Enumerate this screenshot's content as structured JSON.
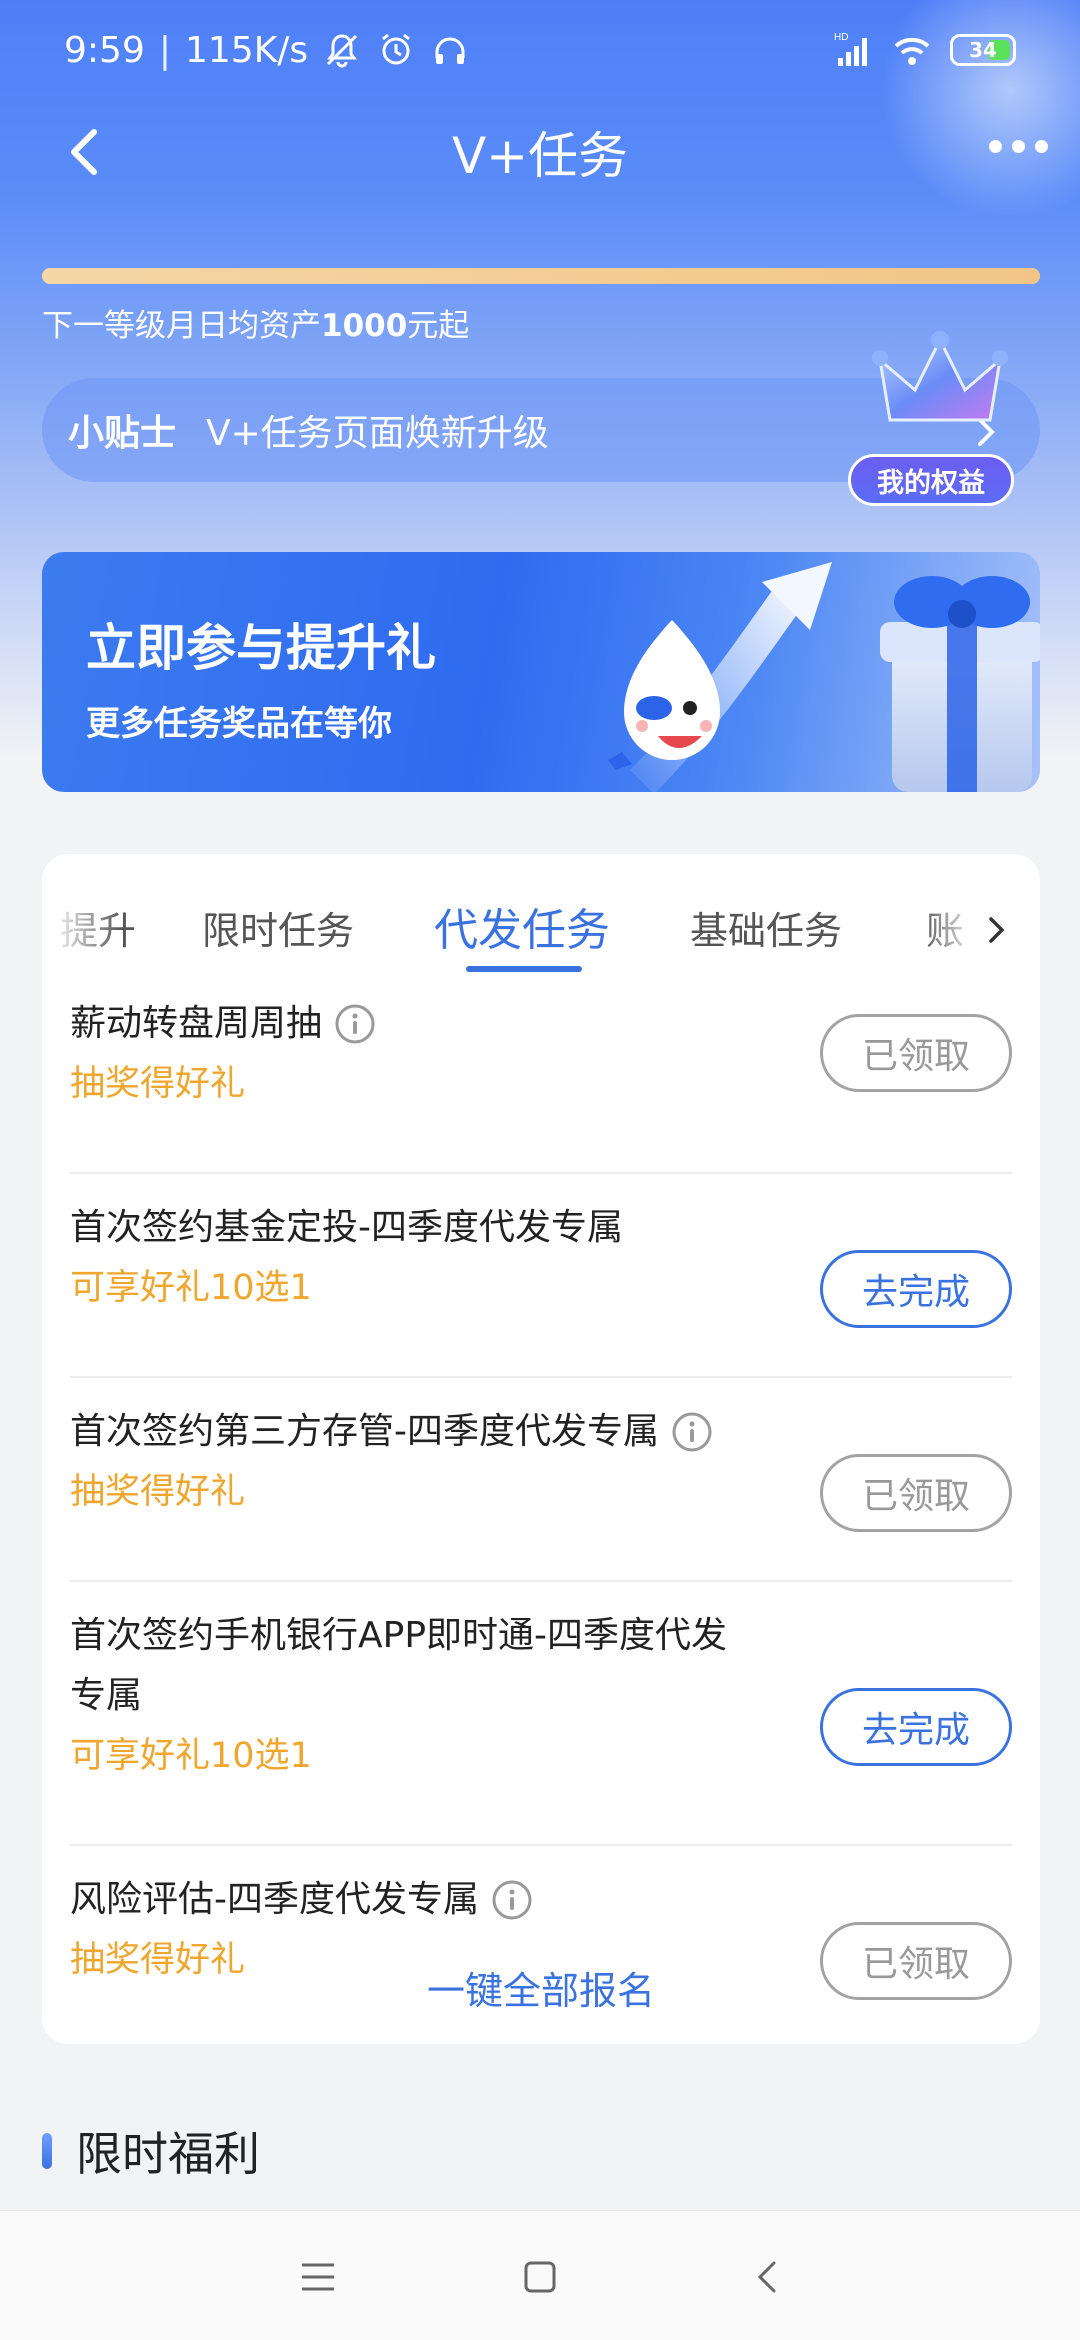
{
  "status_bar": {
    "time": "9:59",
    "separator": "|",
    "network_speed": "115K/s",
    "signal_label": "HD",
    "battery": "34"
  },
  "nav": {
    "title": "V+任务"
  },
  "level": {
    "progress": 1.0,
    "hint_prefix": "下一等级月日均资产",
    "hint_amount": "1000",
    "hint_suffix": "元起"
  },
  "tips": {
    "label": "小贴士",
    "text": "V+任务页面焕新升级",
    "rights_badge": "我的权益"
  },
  "banner": {
    "title": "立即参与提升礼",
    "subtitle": "更多任务奖品在等你"
  },
  "tabs": [
    {
      "label": "提升",
      "active": false
    },
    {
      "label": "限时任务",
      "active": false
    },
    {
      "label": "代发任务",
      "active": true
    },
    {
      "label": "基础任务",
      "active": false
    },
    {
      "label": "账",
      "active": false
    }
  ],
  "tasks": [
    {
      "title": "薪动转盘周周抽",
      "has_info": true,
      "reward": "抽奖得好礼",
      "button": "已领取",
      "state": "done"
    },
    {
      "title": "首次签约基金定投-四季度代发专属",
      "has_info": false,
      "reward": "可享好礼10选1",
      "button": "去完成",
      "state": "go"
    },
    {
      "title": "首次签约第三方存管-四季度代发专属",
      "has_info": true,
      "reward": "抽奖得好礼",
      "button": "已领取",
      "state": "done"
    },
    {
      "title_line1": "首次签约手机银行APP即时通-四季度代发",
      "title_line2": "专属",
      "has_info": false,
      "reward": "可享好礼10选1",
      "button": "去完成",
      "state": "go"
    },
    {
      "title": "风险评估-四季度代发专属",
      "has_info": true,
      "reward": "抽奖得好礼",
      "button": "已领取",
      "state": "done"
    }
  ],
  "one_key_signup": "一键全部报名",
  "section": {
    "title": "限时福利"
  },
  "colors": {
    "accent": "#3a72e0",
    "reward": "#f0a52c",
    "hero": "#4f7ff7"
  },
  "icons": [
    "back-arrow-icon",
    "more-icon",
    "info-icon",
    "chevron-right-icon",
    "crown-icon",
    "gift-icon",
    "mascot-icon",
    "menu-icon",
    "home-square-icon",
    "back-triangle-icon"
  ]
}
